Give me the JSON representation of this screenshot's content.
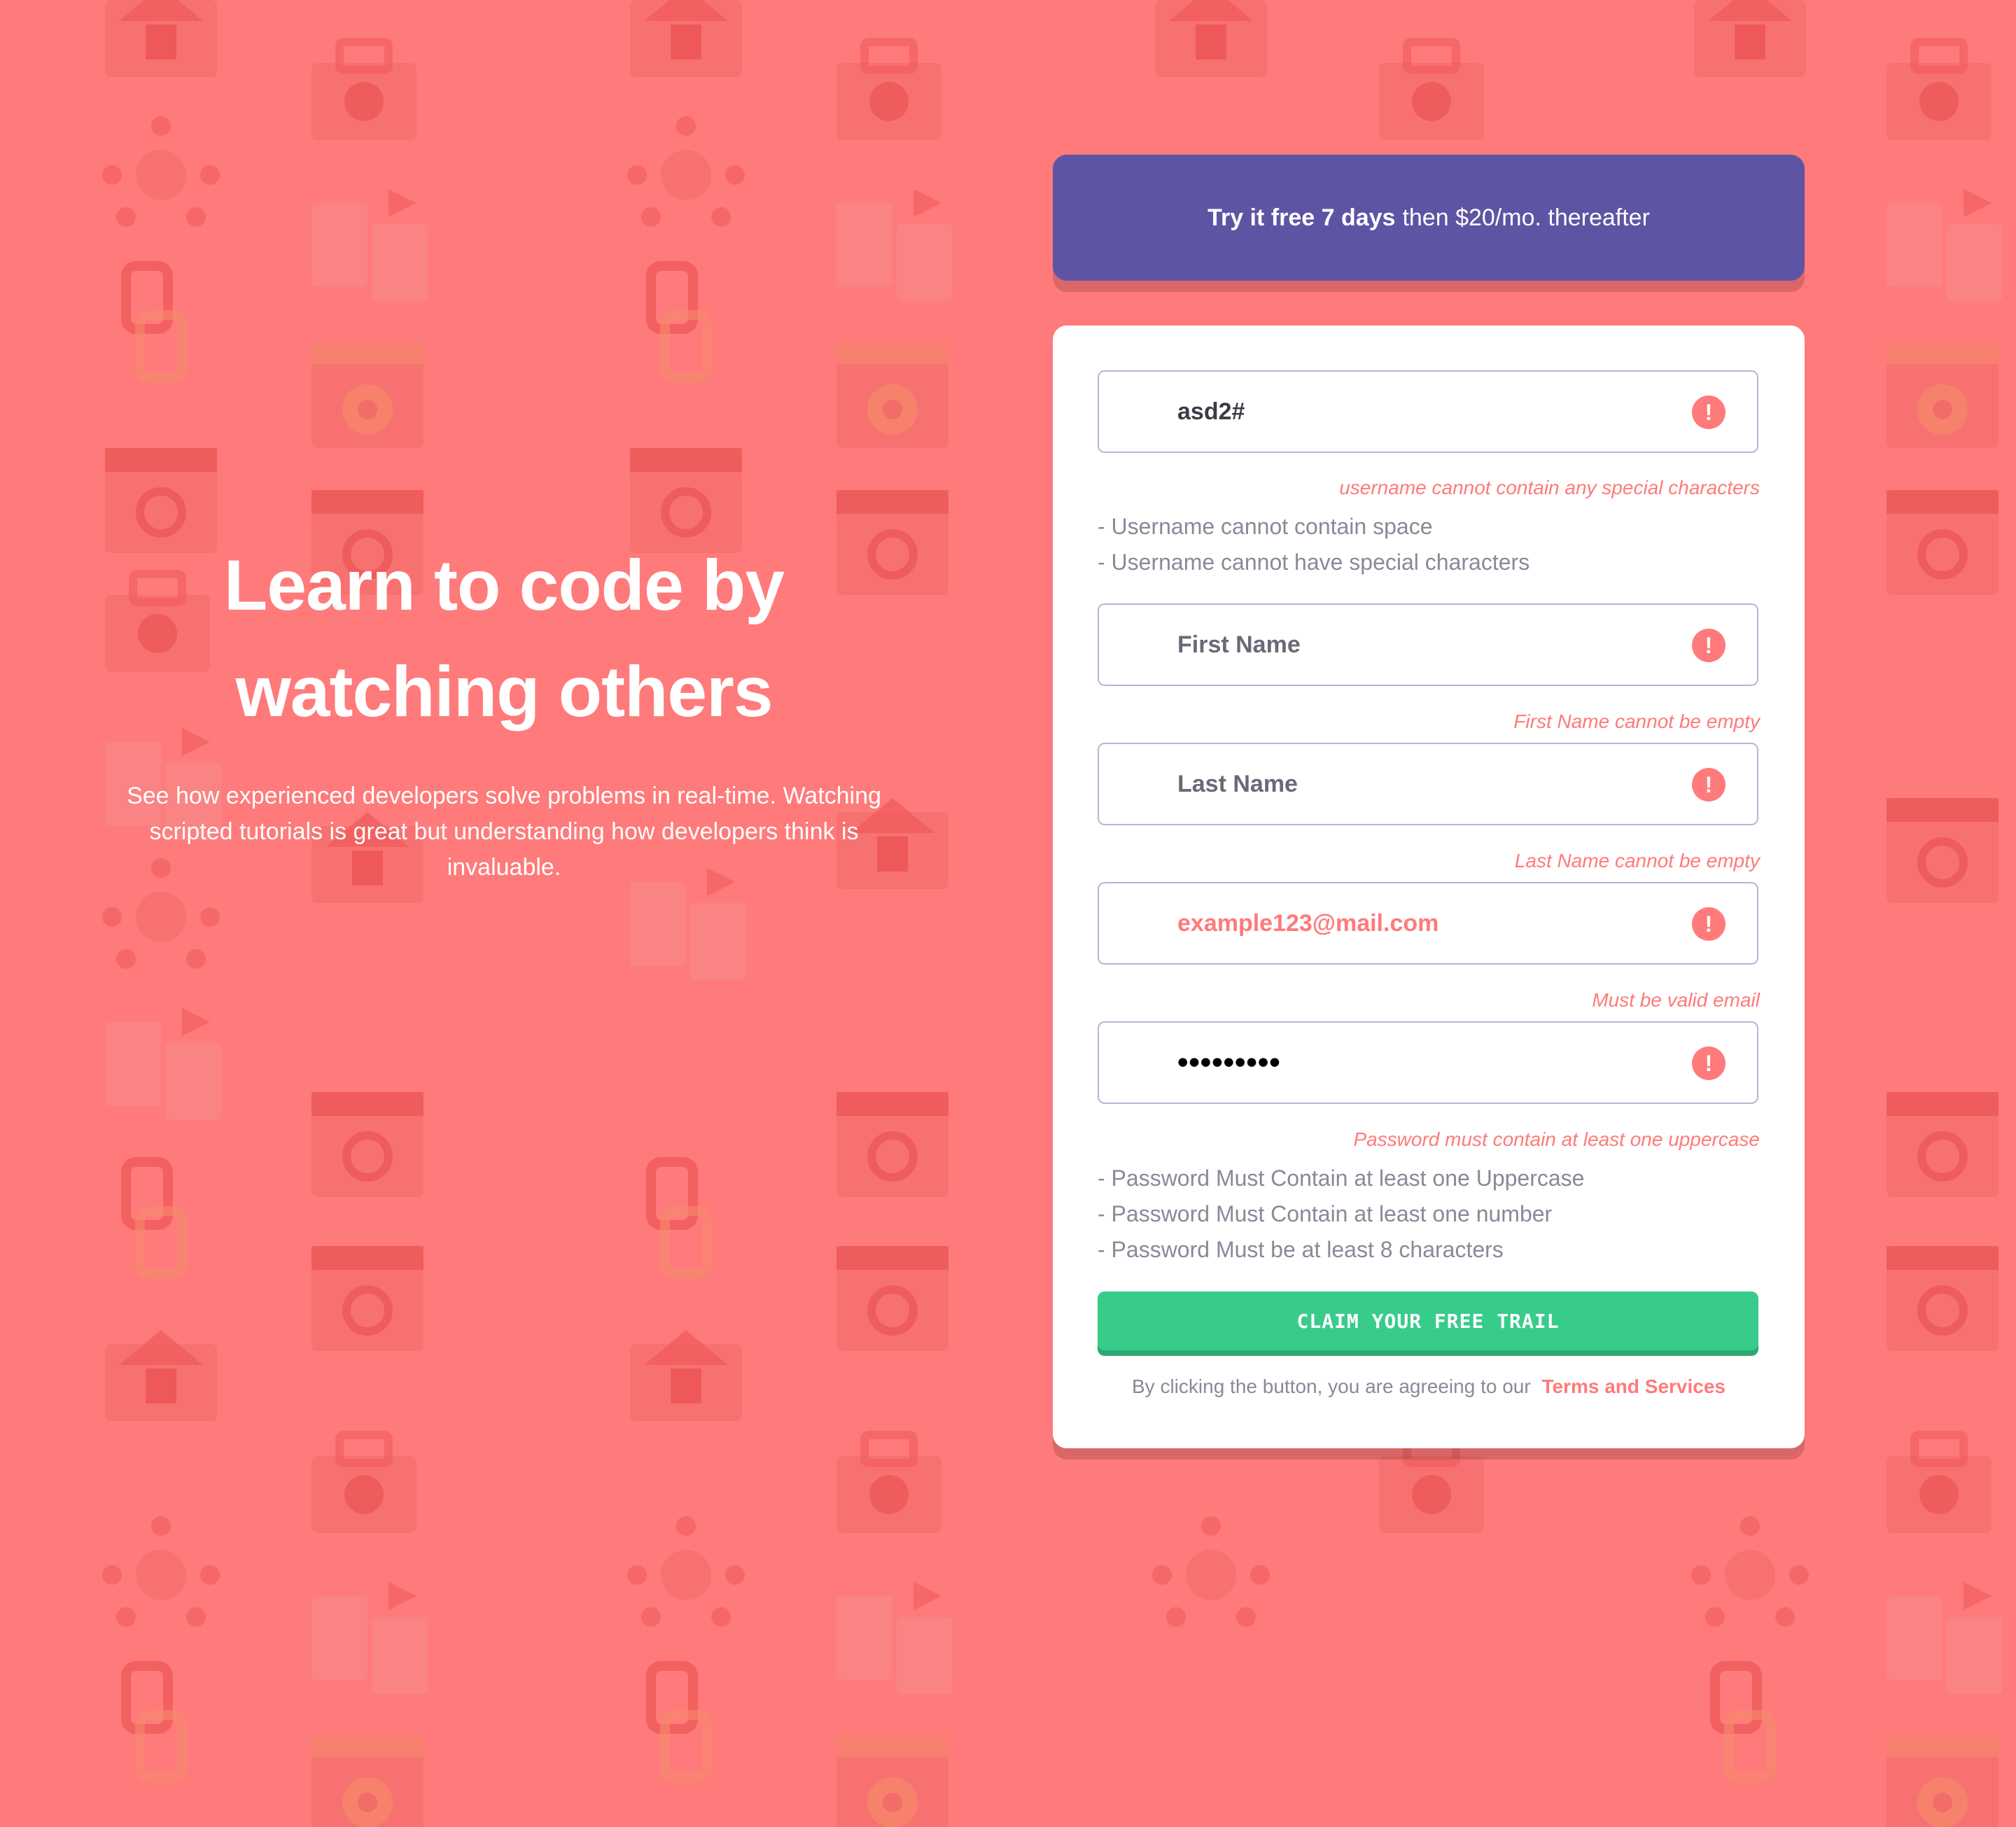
{
  "colors": {
    "background": "#ff7a7a",
    "promo": "#5e54a4",
    "accent_red": "#ff7a7a",
    "cta_green": "#38cc8b",
    "card": "#ffffff"
  },
  "intro": {
    "title_line1": "Learn to code by",
    "title_line2": "watching others",
    "description": "See how experienced developers solve problems in real-time. Watching scripted tutorials is great but understanding how developers think is invaluable."
  },
  "promo": {
    "bold": "Try it free 7 days",
    "rest": "then $20/mo. thereafter"
  },
  "form": {
    "username": {
      "value": "asd2#",
      "icon": "error-icon",
      "error": "username cannot contain any special characters",
      "hints": [
        "- Username cannot contain space",
        "- Username cannot have special characters"
      ]
    },
    "first_name": {
      "placeholder": "First Name",
      "icon": "error-icon",
      "error": "First Name cannot be empty"
    },
    "last_name": {
      "placeholder": "Last Name",
      "icon": "error-icon",
      "error": "Last Name cannot be empty"
    },
    "email": {
      "placeholder": "example123@mail.com",
      "icon": "error-icon",
      "error": "Must be valid email"
    },
    "password": {
      "value": "•••••••••",
      "icon": "error-icon",
      "error": "Password must contain at least one uppercase",
      "hints": [
        "- Password Must Contain at least one Uppercase",
        "- Password Must Contain at least one number",
        "- Password Must be at least 8 characters"
      ]
    },
    "submit_label": "CLAIM YOUR FREE TRAIL",
    "terms_prefix": "By clicking the button, you are agreeing to our",
    "terms_link": "Terms and Services",
    "error_icon_glyph": "!"
  }
}
